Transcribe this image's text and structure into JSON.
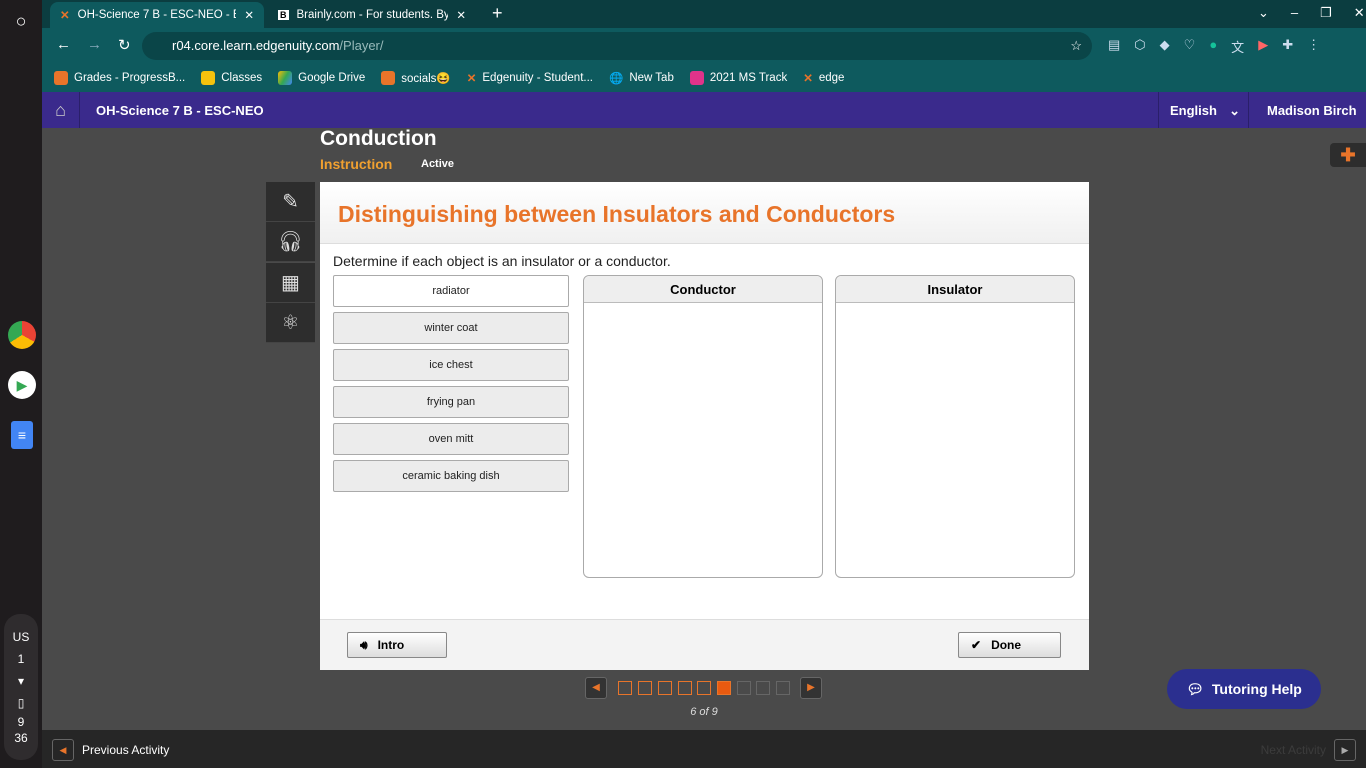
{
  "browser": {
    "tabs": [
      {
        "title": "OH-Science 7 B - ESC-NEO - Edgenuity"
      },
      {
        "title": "Brainly.com - For students. By students."
      }
    ],
    "url_host": "r04.core.learn.edgenuity.com",
    "url_path": "/Player/",
    "bookmarks": [
      "Grades - ProgressB...",
      "Classes",
      "Google Drive",
      "socials😆",
      "Edgenuity - Student...",
      "New Tab",
      "2021 MS Track",
      "edge"
    ]
  },
  "shelf": {
    "locale": "US",
    "notifications": "1",
    "time_h": "9",
    "time_m": "36"
  },
  "topnav": {
    "course": "OH-Science 7 B - ESC-NEO",
    "language": "English",
    "user": "Madison Birch"
  },
  "lesson": {
    "title": "Conduction",
    "tab_instruction": "Instruction",
    "status": "Active"
  },
  "activity": {
    "heading": "Distinguishing between Insulators and Conductors",
    "prompt": "Determine if each object is an insulator or a conductor.",
    "items": [
      "radiator",
      "winter coat",
      "ice chest",
      "frying pan",
      "oven mitt",
      "ceramic baking dish"
    ],
    "bins": [
      "Conductor",
      "Insulator"
    ],
    "intro": "Intro",
    "done": "Done"
  },
  "pager": {
    "current": 6,
    "total": 9,
    "label": "6 of 9"
  },
  "tutoring": "Tutoring Help",
  "footer": {
    "prev": "Previous Activity",
    "next": "Next Activity"
  }
}
